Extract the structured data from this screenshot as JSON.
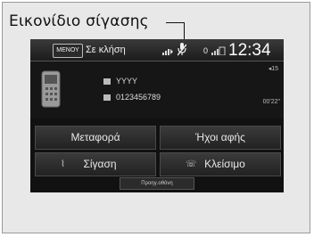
{
  "callout": {
    "label": "Εικονίδιο σίγασης"
  },
  "status_bar": {
    "menu_label": "ΜΕΝΟΥ",
    "status_text": "Σε κλήση",
    "signal_value": "0",
    "clock": "12:34"
  },
  "call": {
    "volume": "◂15",
    "caller_name": "YYYY",
    "caller_number": "0123456789",
    "elapsed": "00'22\""
  },
  "buttons": {
    "transfer": "Μεταφορά",
    "touch_tones": "Ήχοι αφής",
    "mute": "Σίγαση",
    "hang_up": "Κλείσιμο",
    "previous": "Προηγ.οθόνη"
  },
  "icons": {
    "phone": "phone-icon",
    "mute": "mute-icon",
    "signal": "signal-icon",
    "battery": "battery-bars-icon"
  }
}
